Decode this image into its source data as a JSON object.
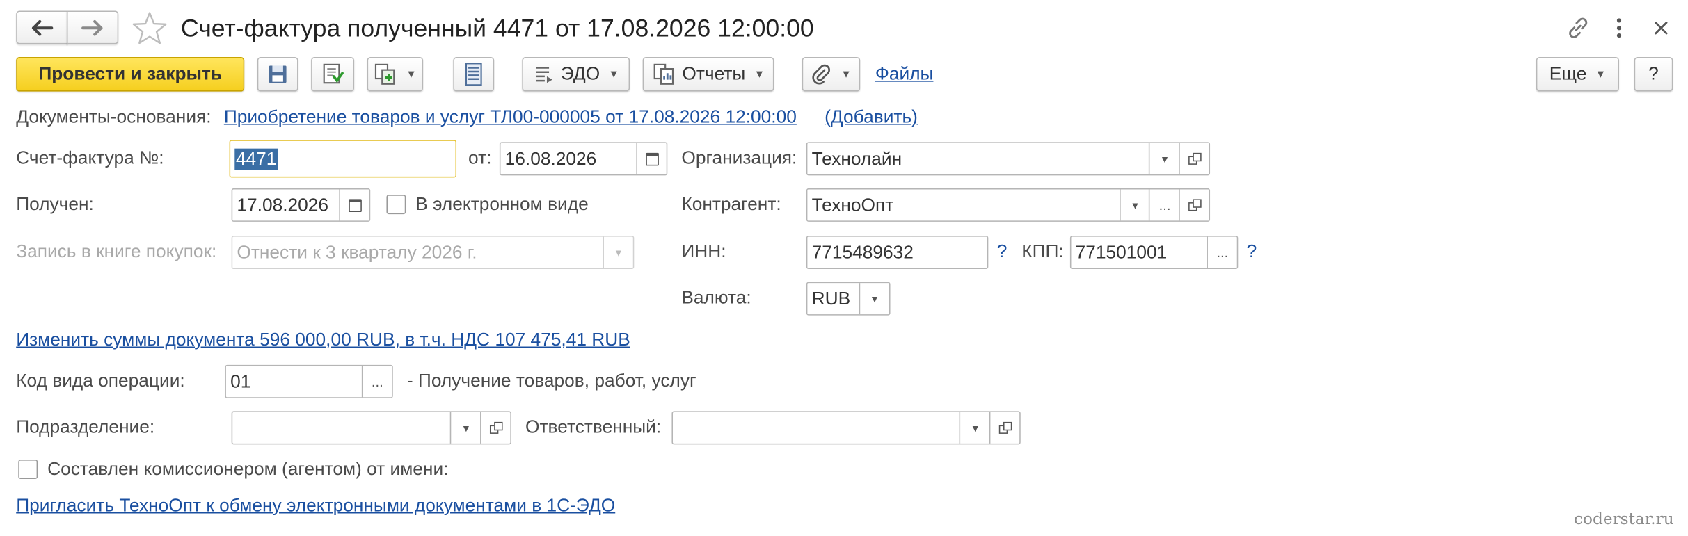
{
  "window": {
    "title": "Счет-фактура полученный 4471 от 17.08.2026 12:00:00",
    "back_icon": "arrow-left-icon",
    "forward_icon": "arrow-right-icon",
    "favorite_icon": "star-icon",
    "link_icon": "link-icon",
    "menu_icon": "more-vertical-icon",
    "close_icon": "close-icon"
  },
  "toolbar": {
    "post_close_label": "Провести и закрыть",
    "edo_label": "ЭДО",
    "reports_label": "Отчеты",
    "files_label": "Файлы",
    "more_label": "Еще",
    "help_label": "?"
  },
  "basis": {
    "label": "Документы-основания:",
    "doc_link": "Приобретение товаров и услуг ТЛ00-000005 от 17.08.2026 12:00:00",
    "add_link": "(Добавить)"
  },
  "form": {
    "invoice_no_label": "Счет-фактура №:",
    "invoice_no_value": "4471",
    "from_label": "от:",
    "from_value": "16.08.2026",
    "received_label": "Получен:",
    "received_value": "17.08.2026",
    "electronic_label": "В электронном виде",
    "ledger_label": "Запись в книге покупок:",
    "ledger_value": "Отнести к 3 кварталу 2026 г.",
    "org_label": "Организация:",
    "org_value": "Технолайн",
    "counterparty_label": "Контрагент:",
    "counterparty_value": "ТехноОпт",
    "inn_label": "ИНН:",
    "inn_value": "7715489632",
    "kpp_label": "КПП:",
    "kpp_value": "771501001",
    "question_mark": "?",
    "currency_label": "Валюта:",
    "currency_value": "RUB",
    "change_sums_link": "Изменить суммы документа 596 000,00 RUB, в т.ч. НДС 107 475,41 RUB",
    "op_code_label": "Код вида операции:",
    "op_code_value": "01",
    "op_code_desc": "- Получение товаров, работ, услуг",
    "division_label": "Подразделение:",
    "division_value": "",
    "responsible_label": "Ответственный:",
    "responsible_value": "",
    "commission_label": "Составлен комиссионером (агентом) от имени:",
    "invite_link": "Пригласить ТехноОпт к обмену электронными документами в 1С-ЭДО",
    "ellipsis": "..."
  },
  "watermark": "coderstar.ru"
}
